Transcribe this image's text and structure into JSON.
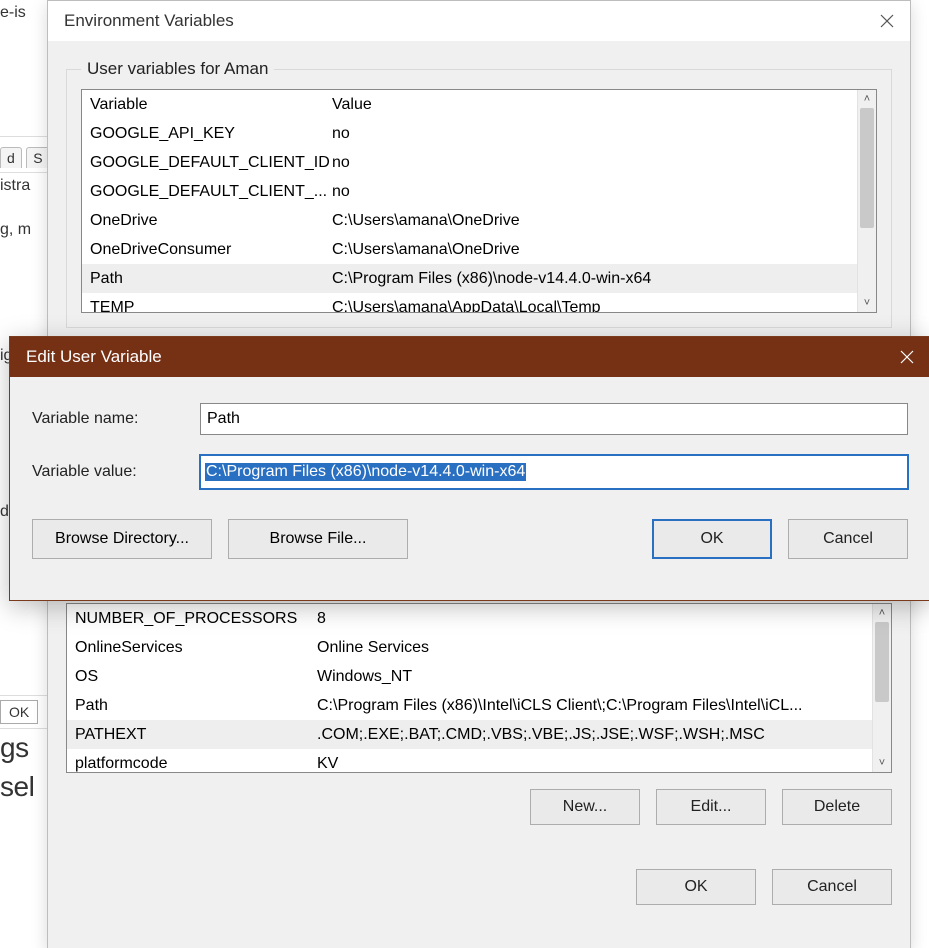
{
  "bg": {
    "frag1": "e-is",
    "tab_d": "d",
    "tab_s": "S",
    "frag2": "istra",
    "frag3": "g, m",
    "frag4": "ig",
    "frag5": "d deb",
    "ok": "OK",
    "big1": "gs",
    "big2": "sel"
  },
  "env": {
    "title": "Environment Variables",
    "user_legend": "User variables for Aman",
    "col_variable": "Variable",
    "col_value": "Value",
    "user_rows": [
      {
        "var": "GOOGLE_API_KEY",
        "val": "no",
        "sel": false
      },
      {
        "var": "GOOGLE_DEFAULT_CLIENT_ID",
        "val": "no",
        "sel": false
      },
      {
        "var": "GOOGLE_DEFAULT_CLIENT_...",
        "val": "no",
        "sel": false
      },
      {
        "var": "OneDrive",
        "val": "C:\\Users\\amana\\OneDrive",
        "sel": false
      },
      {
        "var": "OneDriveConsumer",
        "val": "C:\\Users\\amana\\OneDrive",
        "sel": false
      },
      {
        "var": "Path",
        "val": "C:\\Program Files (x86)\\node-v14.4.0-win-x64",
        "sel": true
      },
      {
        "var": "TEMP",
        "val": "C:\\Users\\amana\\AppData\\Local\\Temp",
        "sel": false
      }
    ],
    "sys_rows": [
      {
        "var": "NUMBER_OF_PROCESSORS",
        "val": "8",
        "sel": false
      },
      {
        "var": "OnlineServices",
        "val": "Online Services",
        "sel": false
      },
      {
        "var": "OS",
        "val": "Windows_NT",
        "sel": false
      },
      {
        "var": "Path",
        "val": "C:\\Program Files (x86)\\Intel\\iCLS Client\\;C:\\Program Files\\Intel\\iCL...",
        "sel": false
      },
      {
        "var": "PATHEXT",
        "val": ".COM;.EXE;.BAT;.CMD;.VBS;.VBE;.JS;.JSE;.WSF;.WSH;.MSC",
        "sel": true
      },
      {
        "var": "platformcode",
        "val": "KV",
        "sel": false
      }
    ],
    "btn_new": "New...",
    "btn_edit": "Edit...",
    "btn_delete": "Delete",
    "btn_ok": "OK",
    "btn_cancel": "Cancel"
  },
  "edit": {
    "title": "Edit User Variable",
    "lbl_name": "Variable name:",
    "lbl_value": "Variable value:",
    "val_name": "Path",
    "val_value": "C:\\Program Files (x86)\\node-v14.4.0-win-x64",
    "btn_browse_dir": "Browse Directory...",
    "btn_browse_file": "Browse File...",
    "btn_ok": "OK",
    "btn_cancel": "Cancel"
  }
}
